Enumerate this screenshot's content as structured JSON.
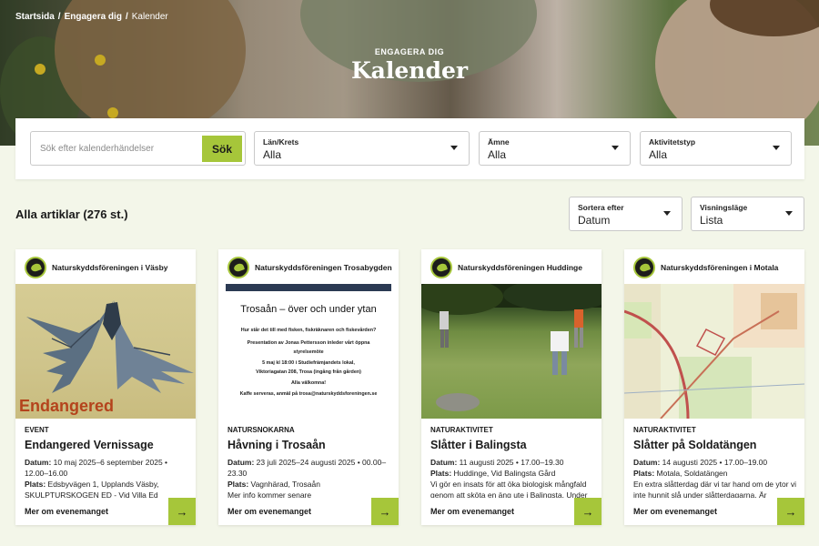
{
  "breadcrumb": {
    "home": "Startsida",
    "sep1": "/",
    "parent": "Engagera dig",
    "sep2": "/",
    "current": "Kalender"
  },
  "hero": {
    "eyebrow": "ENGAGERA DIG",
    "title": "Kalender"
  },
  "search": {
    "placeholder": "Sök efter kalenderhändelser",
    "button": "Sök"
  },
  "filters": [
    {
      "label": "Län/Krets",
      "value": "Alla"
    },
    {
      "label": "Ämne",
      "value": "Alla"
    },
    {
      "label": "Aktivitetstyp",
      "value": "Alla"
    }
  ],
  "list": {
    "title": "Alla artiklar (276 st.)"
  },
  "sort": {
    "label": "Sortera efter",
    "value": "Datum"
  },
  "view": {
    "label": "Visningsläge",
    "value": "Lista"
  },
  "colors": {
    "accent": "#a6c63a",
    "background": "#f3f6e9"
  },
  "cards": [
    {
      "org": "Naturskyddsföreningen i Väsby",
      "category": "EVENT",
      "title": "Endangered Vernissage",
      "date_label": "Datum:",
      "date": "10 maj 2025–6 september 2025 • 12.00–16.00",
      "place_label": "Plats:",
      "place": "Edsbyvägen 1, Upplands Väsby, SKULPTURSKOGEN ED - Vid Villa Ed",
      "image_text": "Endangered",
      "more": "Mer om evenemanget",
      "arrow": "→"
    },
    {
      "org": "Naturskyddsföreningen Trosabygden",
      "category": "NATURSNOKARNA",
      "title": "Håvning i Trosaån",
      "date_label": "Datum:",
      "date": "23 juli 2025–24 augusti 2025 • 00.00–23.30",
      "place_label": "Plats:",
      "place": "Vagnhärad, Trosaån",
      "extra": "Mer info kommer senare",
      "poster": {
        "title": "Trosaån – över och under ytan",
        "lines": [
          "Hur står det till med fisken, fiskräknaren och fiskevården?",
          "Presentation av Jonas Pettersson inleder vårt öppna",
          "styrelsemöte",
          "5 maj kl 18:00 i Studiefrämjandets lokal,",
          "Viktoriagatan 208, Trosa (ingång från gården)",
          "Alla välkomna!",
          "Kaffe serveras, anmäl på trosa@naturskyddsforeningen.se"
        ]
      },
      "more": "Mer om evenemanget",
      "arrow": "→"
    },
    {
      "org": "Naturskyddsföreningen Huddinge",
      "category": "NATURAKTIVITET",
      "title": "Slåtter i Balingsta",
      "date_label": "Datum:",
      "date": "11 augusti 2025 • 17.00–19.30",
      "place_label": "Plats:",
      "place": "Huddinge, Vid Balingsta Gård",
      "extra": "Vi gör en insats för att öka biologisk mångfald genom att sköta en äng ute i Balingsta. Under",
      "more": "Mer om evenemanget",
      "arrow": "→"
    },
    {
      "org": "Naturskyddsföreningen i Motala",
      "category": "NATURAKTIVITET",
      "title": "Slåtter på Soldatängen",
      "date_label": "Datum:",
      "date": "14 augusti 2025 • 17.00–19.00",
      "place_label": "Plats:",
      "place": "Motala, Soldatängen",
      "extra": "En extra slåtterdag där vi tar hand om de ytor vi inte hunnit slå under slåtterdagarna. Är",
      "more": "Mer om evenemanget",
      "arrow": "→"
    }
  ]
}
